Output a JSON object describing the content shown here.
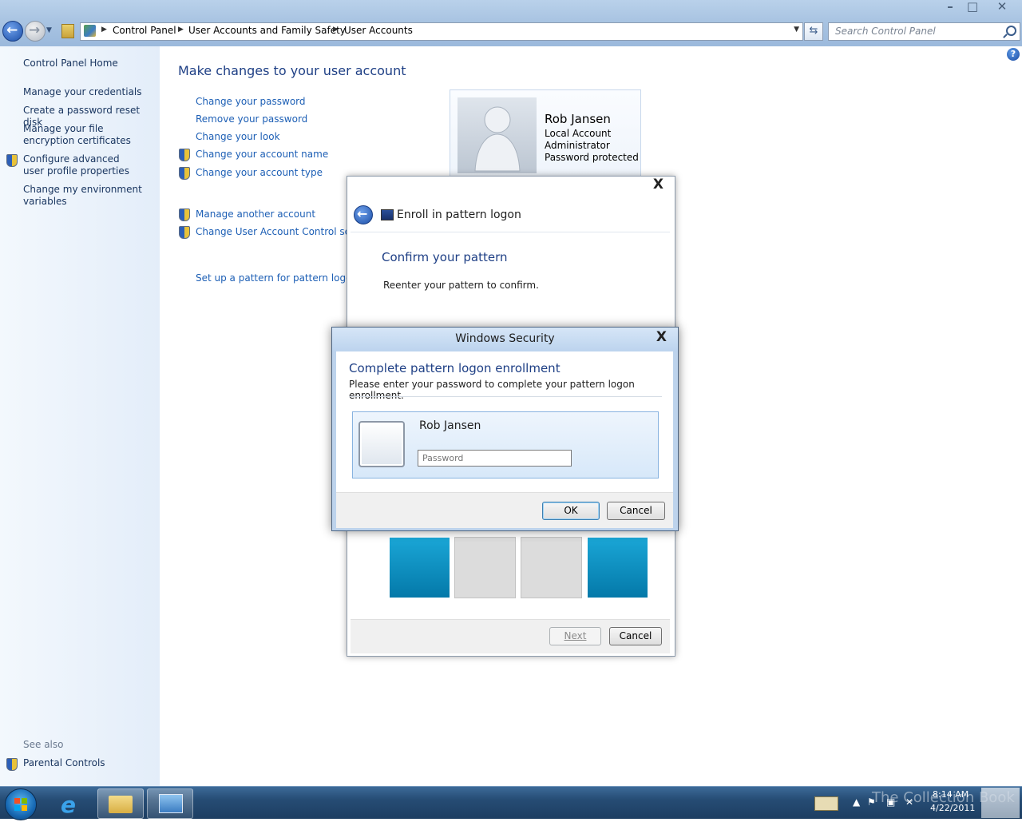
{
  "window": {
    "title": "",
    "controls": {
      "minimize": "–",
      "maximize": "□",
      "close": "✕"
    }
  },
  "address": {
    "crumbs": [
      "Control Panel",
      "User Accounts and Family Safety",
      "User Accounts"
    ],
    "search_placeholder": "Search Control Panel"
  },
  "sidebar": {
    "home": "Control Panel Home",
    "items": [
      {
        "label": "Manage your credentials",
        "shield": false
      },
      {
        "label": "Create a password reset disk",
        "shield": false
      },
      {
        "label": "Manage your file encryption certificates",
        "shield": false
      },
      {
        "label": "Configure advanced user profile properties",
        "shield": true
      },
      {
        "label": "Change my environment variables",
        "shield": false
      }
    ],
    "see_also": "See also",
    "parental_controls": "Parental Controls"
  },
  "main": {
    "title": "Make changes to your user account",
    "links": [
      "Change your password",
      "Remove your password",
      "Change your look",
      "Change your account name",
      "Change your account type",
      "Manage another account",
      "Change User Account Control settin",
      "Set up a pattern for pattern logon"
    ],
    "help": "?"
  },
  "user_card": {
    "name": "Rob Jansen",
    "type": "Local Account",
    "role": "Administrator",
    "status": "Password protected"
  },
  "enroll_dialog": {
    "title": "Enroll in pattern logon",
    "heading": "Confirm your pattern",
    "instruction": "Reenter your pattern to confirm.",
    "close": "X",
    "tiles": [
      "blue",
      "gray",
      "gray",
      "blue"
    ],
    "next_label": "Next",
    "cancel_label": "Cancel"
  },
  "security_dialog": {
    "title": "Windows Security",
    "close": "X",
    "heading": "Complete pattern logon enrollment",
    "description": "Please enter your password to complete your pattern logon enrollment.",
    "user_name": "Rob Jansen",
    "password_placeholder": "Password",
    "ok_label": "OK",
    "cancel_label": "Cancel"
  },
  "taskbar": {
    "time": "8:14 AM",
    "date": "4/22/2011",
    "watermark": "The Collection Book"
  },
  "colors": {
    "link": "#1d5fb5",
    "heading": "#1e3f85",
    "tile_blue": "#0a8fc2",
    "tile_gray": "#dcdcdc"
  }
}
